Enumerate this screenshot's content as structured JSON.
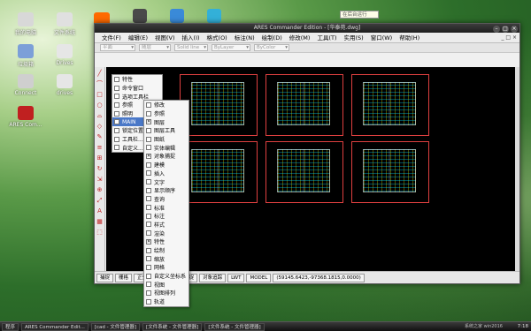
{
  "desktop": {
    "icons": [
      {
        "label": "我的电脑",
        "color": "#d8d8d8"
      },
      {
        "label": "文件系统",
        "color": "#e0e0e0"
      },
      {
        "label": "Pi",
        "color": "#ff6a00"
      },
      {
        "label": "垃圾箱",
        "color": "#7c9fd8"
      },
      {
        "label": "Drives",
        "color": "#e6e6e6"
      },
      {
        "label": "Connect",
        "color": "#cfcfcf"
      },
      {
        "label": "drives",
        "color": "#e6e6e6"
      },
      {
        "label": "ARES Com...",
        "color": "#c02020"
      }
    ],
    "top_icons": [
      {
        "color": "#4a4a4a"
      },
      {
        "color": "#3a8ad8"
      },
      {
        "color": "#33b0d8"
      }
    ]
  },
  "tooltip": "在后台运行",
  "window": {
    "title": "ARES Commander Edition - [华泰苑.dwg]",
    "menu": [
      "文件(F)",
      "编辑(E)",
      "视图(V)",
      "插入(I)",
      "格式(O)",
      "标注(N)",
      "绘制(D)",
      "修改(M)",
      "工具(T)",
      "实用(S)",
      "窗口(W)",
      "帮助(H)"
    ],
    "menu_right": "_ □ ×",
    "toolbar": {
      "layer": "随层",
      "linetype": "Solid line",
      "line2": "ByLayer",
      "color": "ByColor",
      "layer2": "平面"
    },
    "vtool_glyphs": [
      "╱",
      "⌒",
      "□",
      "○",
      "⌓",
      "◇",
      "✎",
      "≡",
      "⊞",
      "↻",
      "⇲",
      "⊕",
      "⤢",
      "A",
      "▦",
      "⬚"
    ],
    "sheet_tabs": [
      "模型",
      "布局"
    ],
    "status": [
      "捕捉",
      "栅格",
      "正交",
      "极轴",
      "对象捕捉",
      "对象追踪",
      "LWT",
      "MODEL",
      "(59145.6423,-97368.1815,0.0000)"
    ]
  },
  "menu1": [
    "特性",
    "命令窗口",
    "选项工具栏",
    "参照",
    "照明",
    "MAIN",
    "锁定位置",
    "工具栏...",
    "自定义..."
  ],
  "menu1_checks": [
    "",
    "",
    "",
    "",
    "",
    "",
    "",
    "",
    ""
  ],
  "menu2": [
    "修改",
    "参照",
    "图层",
    "图层工具",
    "图纸",
    "实体编辑",
    "对象捕捉",
    "建模",
    "插入",
    "文字",
    "显示顺序",
    "查询",
    "标准",
    "标注",
    "样式",
    "渲染",
    "特性",
    "绘制",
    "缩放",
    "网格",
    "自定义坐标系",
    "视图",
    "视图排列",
    "轨道"
  ],
  "menu2_checks": [
    "",
    "",
    "✕",
    "",
    "",
    "",
    "✕",
    "",
    "",
    "",
    "",
    "",
    "",
    "",
    "",
    "",
    "✕",
    "",
    "",
    "",
    "",
    "",
    "",
    ""
  ],
  "taskbar": {
    "items": [
      "程序",
      "ARES Commander Edit...",
      "[cad - 文件管理器]",
      "[文件系统 - 文件管理器]",
      "[文件系统 - 文件管理器]"
    ],
    "time": "7:18",
    "watermark": "系统之家 win2016"
  },
  "colors": {
    "accent": "#4a78c8",
    "sheet_border": "#e04040"
  }
}
